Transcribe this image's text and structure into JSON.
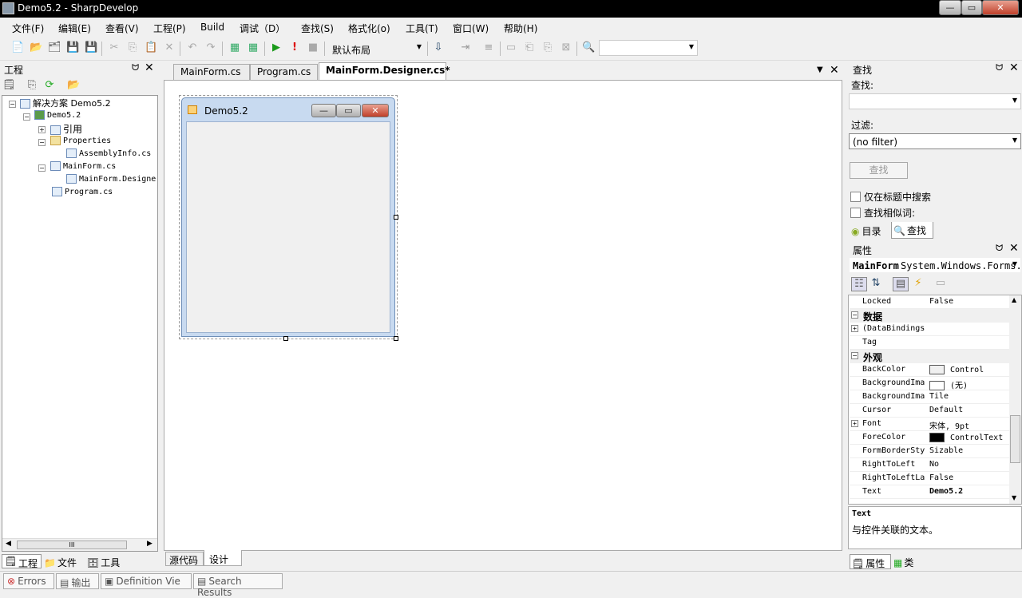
{
  "window": {
    "title": "Demo5.2 - SharpDevelop"
  },
  "menu": [
    "文件(F)",
    "编辑(E)",
    "查看(V)",
    "工程(P)",
    "Build",
    "调试（D）",
    "查找(S)",
    "格式化(o)",
    "工具(T)",
    "窗口(W)",
    "帮助(H)"
  ],
  "toolbar": {
    "layout_value": "默认布局",
    "search_value": ""
  },
  "project_panel": {
    "title": "工程",
    "tree": [
      {
        "label": "解决方案 Demo5.2"
      },
      {
        "label": "Demo5.2"
      },
      {
        "label": "引用"
      },
      {
        "label": "Properties"
      },
      {
        "label": "AssemblyInfo.cs"
      },
      {
        "label": "MainForm.cs"
      },
      {
        "label": "MainForm.Designer.cs"
      },
      {
        "label": "Program.cs"
      }
    ],
    "scroll_glyph": "III",
    "bottom_tabs": [
      "工程",
      "文件",
      "工具"
    ]
  },
  "editor": {
    "tabs": [
      "MainForm.cs",
      "Program.cs",
      "MainForm.Designer.cs*"
    ],
    "form_title": "Demo5.2",
    "bottom_tabs": [
      "源代码",
      "设计"
    ]
  },
  "search_panel": {
    "title": "查找",
    "find_label": "查找:",
    "find_value": "",
    "filter_label": "过滤:",
    "filter_value": "(no filter)",
    "search_button": "查找",
    "opt_title_only": "仅在标题中搜索",
    "opt_similar": "查找相似词:",
    "tabs": [
      "目录",
      "查找"
    ]
  },
  "properties_panel": {
    "title": "属性",
    "object_name": "MainForm",
    "object_type": "System.Windows.Forms.F",
    "rows": [
      {
        "name": "Locked",
        "value": "False"
      },
      {
        "category": "数据"
      },
      {
        "name": "(DataBindings",
        "value": "",
        "expand": true
      },
      {
        "name": "Tag",
        "value": ""
      },
      {
        "category": "外观"
      },
      {
        "name": "BackColor",
        "value": "Control",
        "swatch": "#f0f0f0"
      },
      {
        "name": "BackgroundIma",
        "value": "(无)",
        "swatch": "#ffffff"
      },
      {
        "name": "BackgroundIma",
        "value": "Tile"
      },
      {
        "name": "Cursor",
        "value": "Default"
      },
      {
        "name": "Font",
        "value": "宋体, 9pt",
        "expand": true
      },
      {
        "name": "ForeColor",
        "value": "ControlText",
        "swatch": "#000000"
      },
      {
        "name": "FormBorderSty",
        "value": "Sizable"
      },
      {
        "name": "RightToLeft",
        "value": "No"
      },
      {
        "name": "RightToLeftLa",
        "value": "False"
      },
      {
        "name": "Text",
        "value": "Demo5.2",
        "bold_value": true
      }
    ],
    "desc_title": "Text",
    "desc_text": "与控件关联的文本。",
    "bottom_tabs": [
      "属性",
      "类"
    ]
  },
  "output_tabs": [
    "Errors",
    "输出",
    "Definition Vie",
    "Search Results"
  ]
}
